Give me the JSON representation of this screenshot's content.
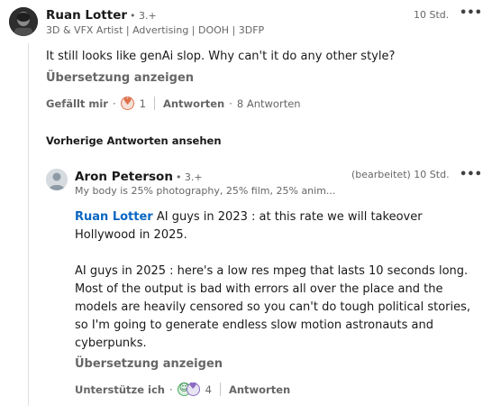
{
  "comment": {
    "author": "Ruan Lotter",
    "degree": "• 3.+",
    "headline": "3D & VFX Artist | Advertising | DOOH | 3DFP",
    "time": "10 Std.",
    "text": "It still looks like genAi slop. Why can't it do any other style?",
    "translate": "Übersetzung anzeigen",
    "like_label": "Gefällt mir",
    "reaction_count": "1",
    "reply_label": "Antworten",
    "replies_count": "8 Antworten"
  },
  "previous_replies": "Vorherige Antworten ansehen",
  "reply": {
    "author": "Aron Peterson",
    "degree": "• 3.+",
    "headline": "My body is 25% photography, 25% film, 25% anim...",
    "edited_time": "(bearbeitet) 10 Std.",
    "mention": "Ruan Lotter",
    "paragraph1": "AI guys in 2023 : at this rate we will takeover Hollywood in 2025.",
    "paragraph2": "AI guys in 2025 : here's a low res mpeg that lasts 10 seconds long. Most of the output is bad with errors all over the place and the models are heavily censored so you can't do tough political stories, so I'm going to generate endless slow motion astronauts and cyberpunks.",
    "translate": "Übersetzung anzeigen",
    "support_label": "Unterstütze ich",
    "reaction_count": "4",
    "reply_label": "Antworten"
  },
  "icons": {
    "more": "more-horizontal-icon",
    "heart": "love-reaction-icon",
    "support": "support-reaction-icon",
    "celebrate": "celebrate-reaction-icon"
  }
}
